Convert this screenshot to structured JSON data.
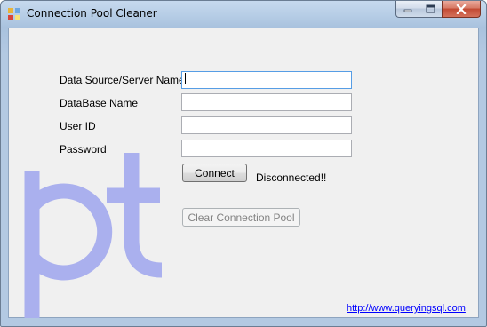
{
  "window": {
    "title": "Connection Pool Cleaner"
  },
  "form": {
    "fields": [
      {
        "label": "Data Source/Server Name",
        "value": ""
      },
      {
        "label": "DataBase Name",
        "value": ""
      },
      {
        "label": "User ID",
        "value": ""
      },
      {
        "label": "Password",
        "value": ""
      }
    ],
    "connect_label": "Connect",
    "status_text": "Disconnected!!",
    "clear_pool_label": "Clear Connection Pool",
    "link_text": "http://www.queryingsql.com"
  },
  "colors": {
    "logo": "#aab0ee",
    "client_bg": "#f0f0f0",
    "link": "#0000ff"
  }
}
